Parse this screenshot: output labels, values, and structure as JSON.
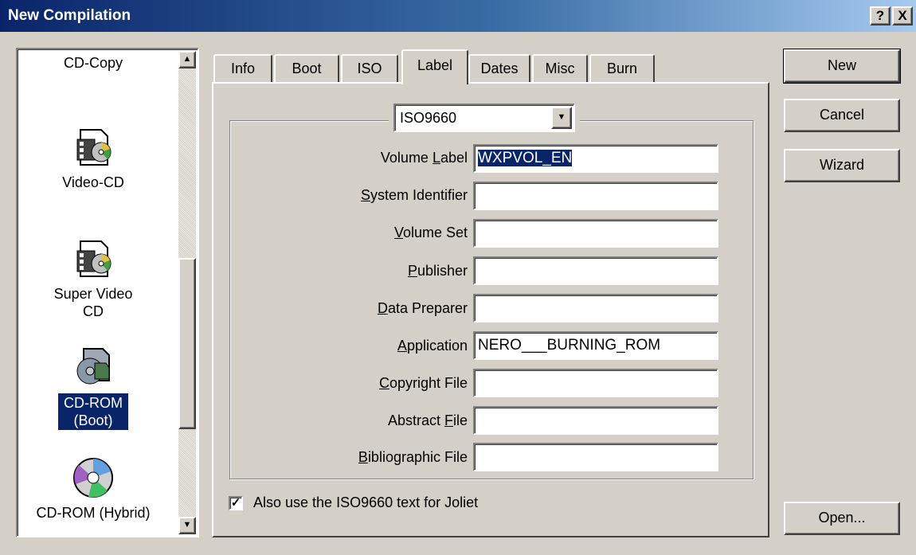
{
  "window": {
    "title": "New Compilation",
    "help_button": "?",
    "close_button": "X"
  },
  "compilation_types": [
    {
      "label": "CD-Copy",
      "icon": "cd-copy-icon",
      "selected": false
    },
    {
      "label": "Video-CD",
      "icon": "video-cd-icon",
      "selected": false
    },
    {
      "label": "Super Video CD",
      "icon": "super-video-cd-icon",
      "selected": false
    },
    {
      "label": "CD-ROM (Boot)",
      "icon": "cd-rom-boot-icon",
      "selected": true
    },
    {
      "label": "CD-ROM (Hybrid)",
      "icon": "cd-rom-disc-icon",
      "selected": false
    }
  ],
  "tabs": [
    {
      "label": "Info",
      "active": false
    },
    {
      "label": "Boot",
      "active": false
    },
    {
      "label": "ISO",
      "active": false
    },
    {
      "label": "Label",
      "active": true
    },
    {
      "label": "Dates",
      "active": false
    },
    {
      "label": "Misc",
      "active": false
    },
    {
      "label": "Burn",
      "active": false
    }
  ],
  "label_tab": {
    "filesystem_select": "ISO9660",
    "fields": [
      {
        "label": "Volume Label",
        "underline": "L",
        "value": "WXPVOL_EN",
        "selected": true
      },
      {
        "label": "System Identifier",
        "underline": "S",
        "value": ""
      },
      {
        "label": "Volume Set",
        "underline": "V",
        "value": ""
      },
      {
        "label": "Publisher",
        "underline": "P",
        "value": ""
      },
      {
        "label": "Data Preparer",
        "underline": "D",
        "value": ""
      },
      {
        "label": "Application",
        "underline": "A",
        "value": "NERO___BURNING_ROM"
      },
      {
        "label": "Copyright File",
        "underline": "C",
        "value": ""
      },
      {
        "label": "Abstract File",
        "underline": "F",
        "value": ""
      },
      {
        "label": "Bibliographic File",
        "underline": "B",
        "value": ""
      }
    ],
    "joliet_checkbox": {
      "label": "Also use the ISO9660 text for Joliet",
      "checked": true
    }
  },
  "buttons": {
    "new": "New",
    "cancel": "Cancel",
    "wizard": "Wizard",
    "open": "Open..."
  },
  "colors": {
    "title_bar": "#0a246a",
    "selection": "#0a246a",
    "face": "#d4d0c8"
  }
}
